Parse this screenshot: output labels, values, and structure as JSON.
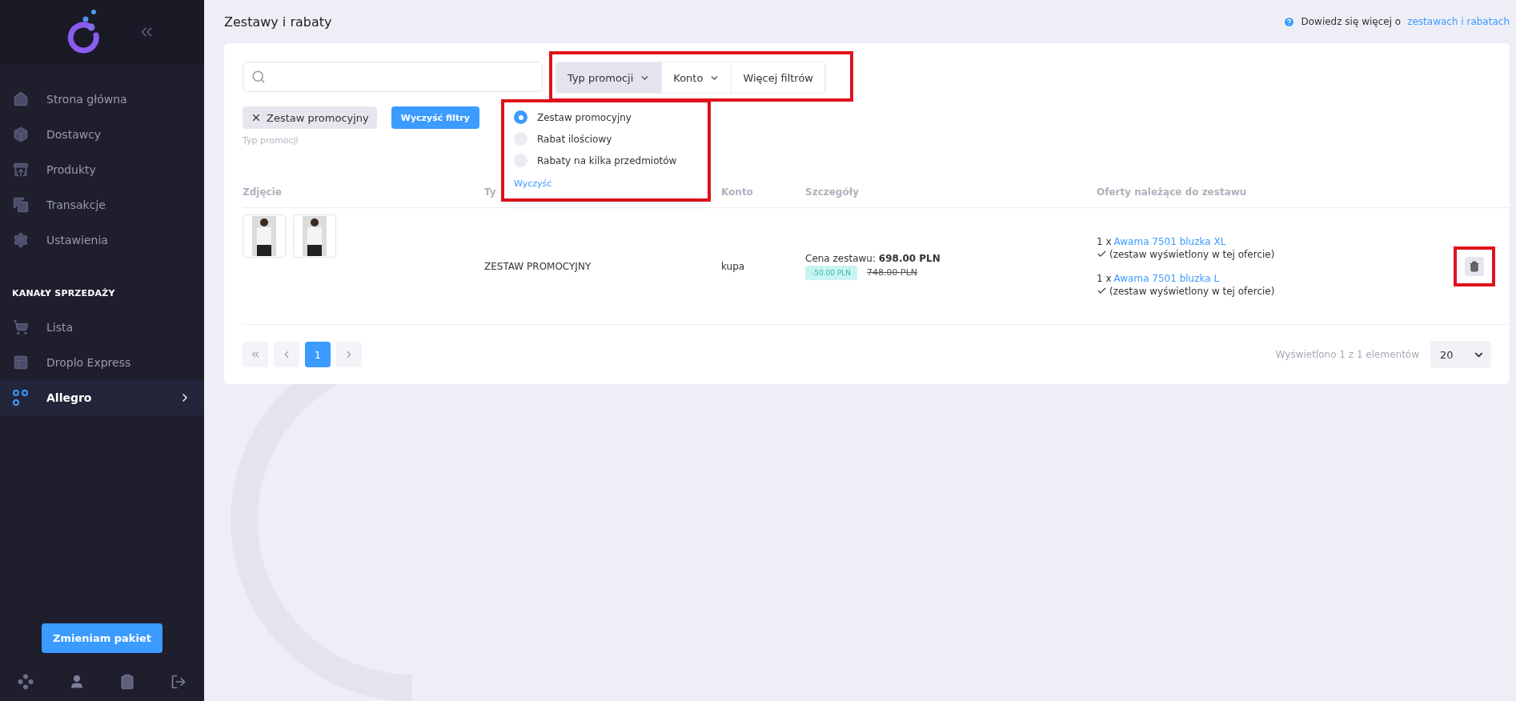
{
  "sidebar": {
    "items": [
      {
        "label": "Strona główna",
        "kind": "home",
        "selected": false
      },
      {
        "label": "Dostawcy",
        "kind": "box",
        "selected": false
      },
      {
        "label": "Produkty",
        "kind": "tray",
        "selected": false
      },
      {
        "label": "Transakcje",
        "kind": "copy",
        "selected": false
      },
      {
        "label": "Ustawienia",
        "kind": "gear",
        "selected": false
      }
    ],
    "section_title": "KANAŁY SPRZEDAŻY",
    "channels": [
      {
        "label": "Lista",
        "kind": "cart",
        "selected": false
      },
      {
        "label": "Droplo Express",
        "kind": "panel",
        "selected": false
      },
      {
        "label": "Allegro",
        "kind": "nodes",
        "selected": true
      }
    ],
    "upgrade_button": "Zmieniam pakiet"
  },
  "page": {
    "title": "Zestawy i rabaty",
    "help_text": "Dowiedz się więcej o",
    "help_link": "zestawach i rabatach"
  },
  "filters": {
    "buttons": [
      {
        "label": "Typ promocji",
        "kind": "dropdown",
        "selected": true
      },
      {
        "label": "Konto",
        "kind": "dropdown",
        "selected": false
      },
      {
        "label": "Więcej filtrów",
        "kind": "button",
        "selected": false
      }
    ],
    "active": [
      {
        "label": "Zestaw promocyjny"
      }
    ],
    "clear_button": "Wyczyść filtry",
    "caption": "Typ promocji",
    "dropdown": {
      "options": [
        {
          "label": "Zestaw promocyjny",
          "selected": true
        },
        {
          "label": "Rabat ilościowy",
          "selected": false
        },
        {
          "label": "Rabaty na kilka przedmiotów",
          "selected": false
        }
      ],
      "clear_link": "Wyczyść"
    }
  },
  "table": {
    "columns": [
      "Zdjęcie",
      "Ty",
      "Konto",
      "Szczegóły",
      "Oferty należące do zestawu"
    ],
    "rows": [
      {
        "photos": [
          {
            "kind": "photo"
          },
          {
            "kind": "photo"
          }
        ],
        "type": "ZESTAW PROMOCYJNY",
        "account": "kupa",
        "details": {
          "price_label": "Cena zestawu:",
          "price": "698.00 PLN",
          "discount": "-50.00 PLN",
          "old_price": "748.00 PLN"
        },
        "offers": [
          {
            "qty": "1 x",
            "name": "Awama 7501 bluzka XL",
            "note": "(zestaw wyświetlony w tej ofercie)",
            "displayed": true
          },
          {
            "qty": "1 x",
            "name": "Awama 7501 bluzka L",
            "note": "(zestaw wyświetlony w tej ofercie)",
            "displayed": true
          }
        ]
      }
    ]
  },
  "pagination": {
    "pages": [
      {
        "label": "1",
        "selected": true
      }
    ],
    "summary": "Wyświetlono 1 z 1 elementów",
    "page_size": "20"
  }
}
